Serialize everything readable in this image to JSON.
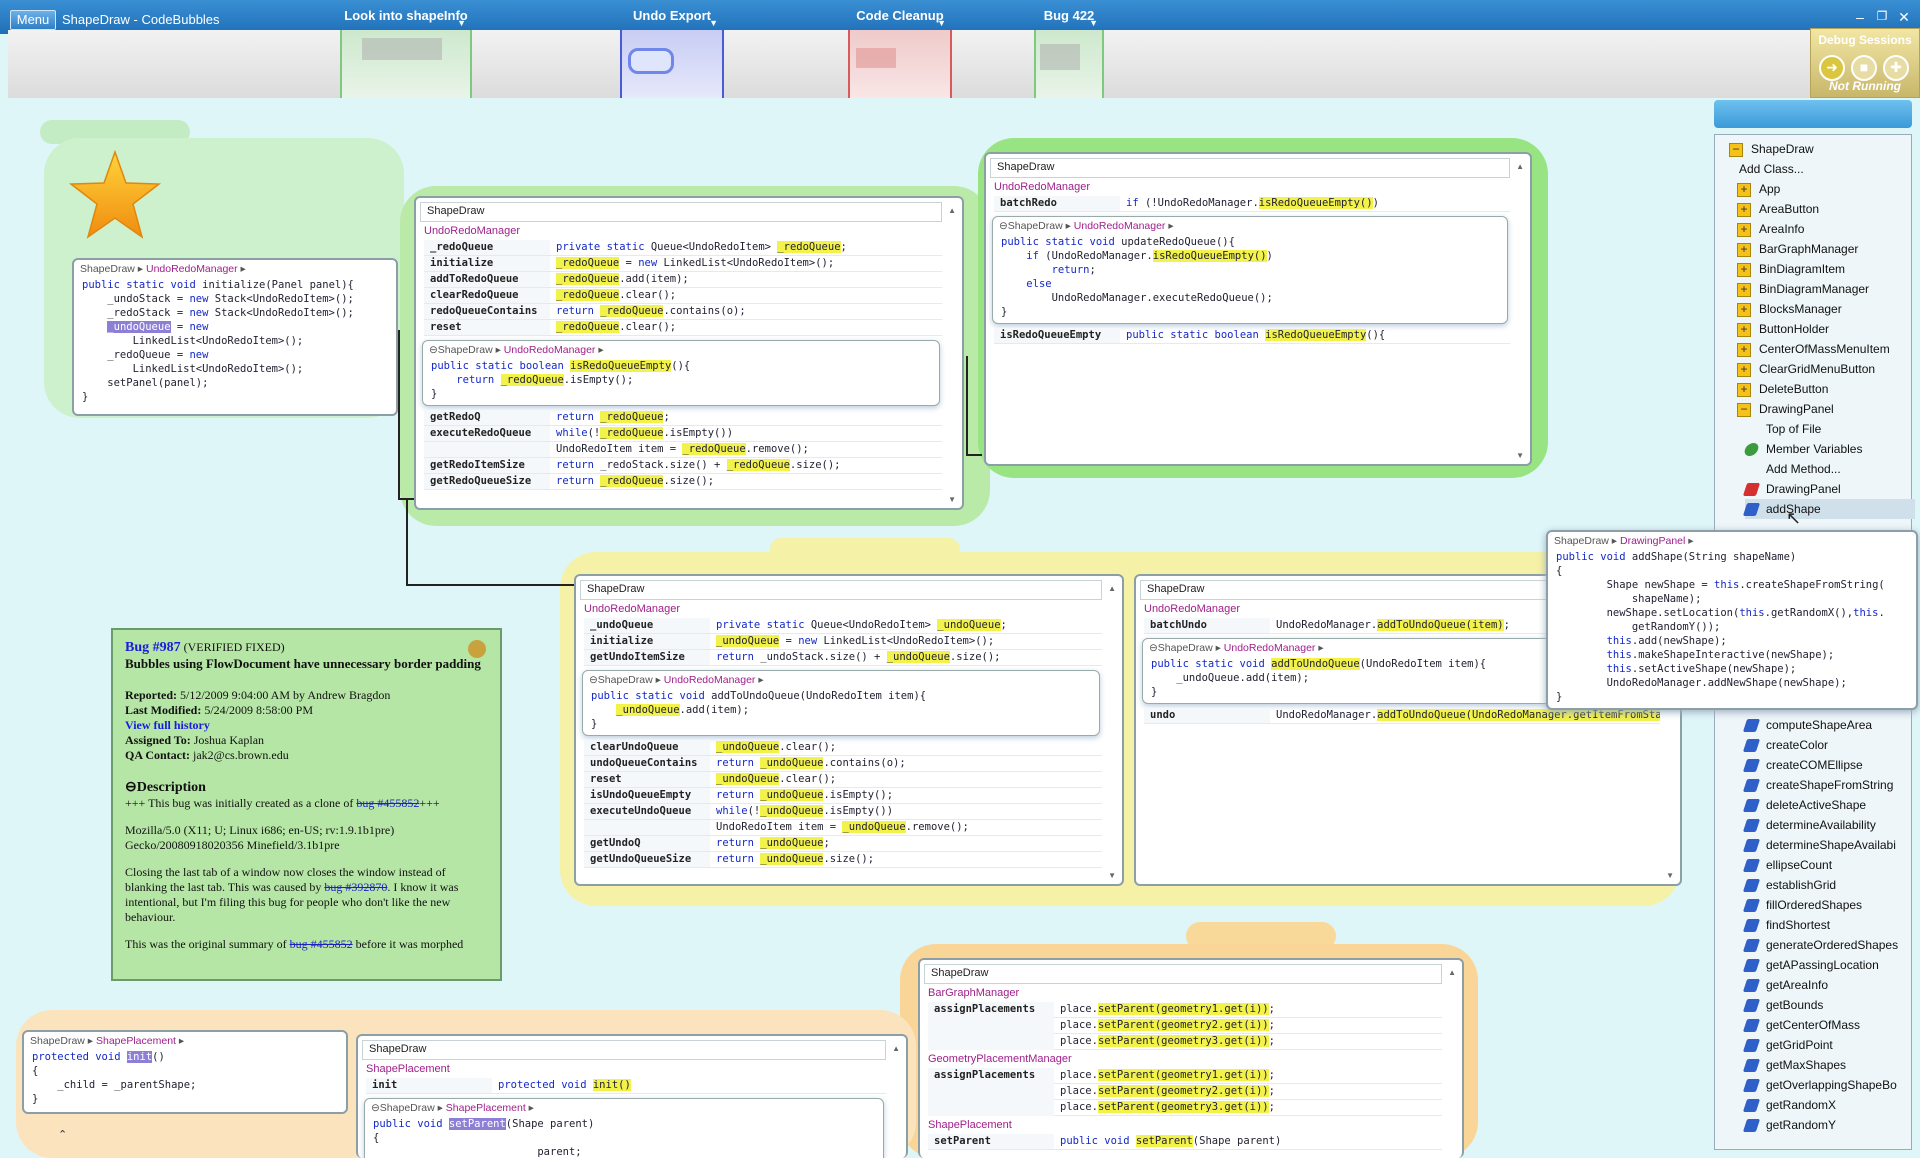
{
  "window": {
    "menu_label": "Menu",
    "title": "ShapeDraw - CodeBubbles"
  },
  "tasks": [
    {
      "label": "Look into shapeInfo",
      "color": "#7fc87f"
    },
    {
      "label": "Undo Export",
      "color": "#4a5ad8"
    },
    {
      "label": "Code Cleanup",
      "color": "#d85a5a"
    },
    {
      "label": "Bug 422",
      "color": "#7fc87f"
    }
  ],
  "debug": {
    "title": "Debug Sessions",
    "status": "Not Running"
  },
  "init_bubble": {
    "project": "ShapeDraw",
    "cls": "UndoRedoManager",
    "lines": [
      "public static void initialize(Panel panel){",
      "    _undoStack = new Stack<UndoRedoItem>();",
      "    _redoStack = new Stack<UndoRedoItem>();",
      "    _undoQueue = new",
      "        LinkedList<UndoRedoItem>();",
      "    _redoQueue = new",
      "        LinkedList<UndoRedoItem>();",
      "    setPanel(panel);",
      "}"
    ]
  },
  "redo_bubble": {
    "project": "ShapeDraw",
    "cls": "UndoRedoManager",
    "rows": [
      {
        "m": "_redoQueue",
        "c": "private static Queue<UndoRedoItem> _redoQueue;"
      },
      {
        "m": "initialize",
        "c": "_redoQueue = new LinkedList<UndoRedoItem>();"
      },
      {
        "m": "addToRedoQueue",
        "c": "_redoQueue.add(item);"
      },
      {
        "m": "clearRedoQueue",
        "c": "_redoQueue.clear();"
      },
      {
        "m": "redoQueueContains",
        "c": "return _redoQueue.contains(o);"
      },
      {
        "m": "reset",
        "c": "_redoQueue.clear();"
      }
    ],
    "inner_crumb": "UndoRedoManager",
    "inner_lines": [
      "public static boolean isRedoQueueEmpty(){",
      "    return _redoQueue.isEmpty();",
      "}"
    ],
    "rows2": [
      {
        "m": "getRedoQ",
        "c": "return _redoQueue;"
      },
      {
        "m": "executeRedoQueue",
        "c": "while(!_redoQueue.isEmpty())"
      },
      {
        "m": "",
        "c": "UndoRedoItem item = _redoQueue.remove();"
      },
      {
        "m": "getRedoItemSize",
        "c": "return _redoStack.size() + _redoQueue.size();"
      },
      {
        "m": "getRedoQueueSize",
        "c": "return _redoQueue.size();"
      }
    ]
  },
  "batch_bubble": {
    "project": "ShapeDraw",
    "cls": "UndoRedoManager",
    "rows": [
      {
        "m": "batchRedo",
        "c": "if (!UndoRedoManager.isRedoQueueEmpty())"
      }
    ],
    "inner_crumb": "UndoRedoManager",
    "inner_lines": [
      "public static void updateRedoQueue(){",
      "    if (UndoRedoManager.isRedoQueueEmpty())",
      "        return;",
      "    else",
      "        UndoRedoManager.executeRedoQueue();",
      "}"
    ],
    "rows2": [
      {
        "m": "isRedoQueueEmpty",
        "c": "public static boolean isRedoQueueEmpty(){"
      }
    ]
  },
  "undo_bubble": {
    "project": "ShapeDraw",
    "cls": "UndoRedoManager",
    "rows": [
      {
        "m": "_undoQueue",
        "c": "private static Queue<UndoRedoItem> _undoQueue;"
      },
      {
        "m": "initialize",
        "c": "_undoQueue = new LinkedList<UndoRedoItem>();"
      },
      {
        "m": "getUndoItemSize",
        "c": "return _undoStack.size() + _undoQueue.size();"
      }
    ],
    "inner_crumb": "UndoRedoManager",
    "inner_lines": [
      "public static void addToUndoQueue(UndoRedoItem item){",
      "    _undoQueue.add(item);",
      "}"
    ],
    "rows2": [
      {
        "m": "clearUndoQueue",
        "c": "_undoQueue.clear();"
      },
      {
        "m": "undoQueueContains",
        "c": "return _undoQueue.contains(o);"
      },
      {
        "m": "reset",
        "c": "_undoQueue.clear();"
      },
      {
        "m": "isUndoQueueEmpty",
        "c": "return _undoQueue.isEmpty();"
      },
      {
        "m": "executeUndoQueue",
        "c": "while(!_undoQueue.isEmpty())"
      },
      {
        "m": "",
        "c": "UndoRedoItem item = _undoQueue.remove();"
      },
      {
        "m": "getUndoQ",
        "c": "return _undoQueue;"
      },
      {
        "m": "getUndoQueueSize",
        "c": "return _undoQueue.size();"
      }
    ]
  },
  "batchundo_bubble": {
    "project": "ShapeDraw",
    "cls": "UndoRedoManager",
    "rows": [
      {
        "m": "batchUndo",
        "c": "UndoRedoManager.addToUndoQueue(item);"
      }
    ],
    "inner_crumb": "UndoRedoManager",
    "inner_lines": [
      "public static void addToUndoQueue(UndoRedoItem item){",
      "    _undoQueue.add(item);",
      "}"
    ],
    "rows2": [
      {
        "m": "undo",
        "c": "UndoRedoManager.addToUndoQueue(UndoRedoManager.getItemFromStack"
      }
    ]
  },
  "addshape_bubble": {
    "project": "ShapeDraw",
    "cls": "DrawingPanel",
    "lines": [
      "public void addShape(String shapeName)",
      "{",
      "        Shape newShape = this.createShapeFromString(",
      "            shapeName);",
      "        newShape.setLocation(this.getRandomX(),this.",
      "            getRandomY());",
      "        this.add(newShape);",
      "        this.makeShapeInteractive(newShape);",
      "        this.setActiveShape(newShape);",
      "        UndoRedoManager.addNewShape(newShape);",
      "}"
    ]
  },
  "bug": {
    "id": "Bug #987",
    "status": "(VERIFIED FIXED)",
    "summary": "Bubbles using FlowDocument have unnecessary border padding",
    "reported_label": "Reported:",
    "reported": "5/12/2009 9:04:00 AM by Andrew Bragdon",
    "modified_label": "Last Modified:",
    "modified": "5/24/2009 8:58:00 PM",
    "history_link": "View full history",
    "assigned_label": "Assigned To:",
    "assigned": "Joshua Kaplan",
    "qa_label": "QA Contact:",
    "qa": "jak2@cs.brown.edu",
    "desc_heading": "Description",
    "p1a": "+++ This bug was initially created as a clone of ",
    "p1link": "bug #455852",
    "p1b": "+++",
    "p2": "Mozilla/5.0 (X11; U; Linux i686; en-US; rv:1.9.1b1pre) Gecko/20080918020356 Minefield/3.1b1pre",
    "p3a": "Closing the last tab of a window now closes the window instead of blanking the last tab. This was caused by ",
    "p3link": "bug #392870",
    "p3b": ". I know it was intentional, but I'm filing this bug for people who don't like the new behaviour.",
    "p4a": "This was the original summary of ",
    "p4link": "bug #455852",
    "p4b": " before it was morphed"
  },
  "init_small": {
    "project": "ShapeDraw",
    "cls": "ShapePlacement",
    "lines": [
      "protected void init()",
      "{",
      "    _child = _parentShape;",
      "}"
    ]
  },
  "placement_bubble": {
    "project": "ShapeDraw",
    "cls": "ShapePlacement",
    "rows": [
      {
        "m": "init",
        "c": "protected void init()"
      }
    ],
    "inner_crumb": "ShapePlacement",
    "inner_lines": [
      "public void setParent(Shape parent)",
      "{",
      "                          parent;"
    ]
  },
  "bargraph_bubble": {
    "project": "ShapeDraw",
    "cls1": "BarGraphManager",
    "m1": "assignPlacements",
    "c1": [
      "place.setParent(geometry1.get(i));",
      "place.setParent(geometry2.get(i));",
      "place.setParent(geometry3.get(i));"
    ],
    "cls2": "GeometryPlacementManager",
    "m2": "assignPlacements",
    "c2": [
      "place.setParent(geometry1.get(i));",
      "place.setParent(geometry2.get(i));",
      "place.setParent(geometry3.get(i));"
    ],
    "cls3": "ShapePlacement",
    "m3": "setParent",
    "c3": "public void setParent(Shape parent)"
  },
  "package_explorer": {
    "root": "ShapeDraw",
    "add_class": "Add Class...",
    "classes": [
      "App",
      "AreaButton",
      "AreaInfo",
      "BarGraphManager",
      "BinDiagramItem",
      "BinDiagramManager",
      "BlocksManager",
      "ButtonHolder",
      "CenterOfMassMenuItem",
      "ClearGridMenuButton",
      "DeleteButton"
    ],
    "expanded": "DrawingPanel",
    "sub_items": [
      {
        "label": "Top of File",
        "icon": "none"
      },
      {
        "label": "Member Variables",
        "icon": "leaf"
      },
      {
        "label": "Add Method...",
        "icon": "none"
      },
      {
        "label": "DrawingPanel",
        "icon": "red"
      },
      {
        "label": "addShape",
        "icon": "blue"
      }
    ],
    "methods": [
      "computeShapeArea",
      "createColor",
      "createCOMEllipse",
      "createShapeFromString",
      "deleteActiveShape",
      "determineAvailability",
      "determineShapeAvailabi",
      "ellipseCount",
      "establishGrid",
      "fillOrderedShapes",
      "findShortest",
      "generateOrderedShapes",
      "getAPassingLocation",
      "getAreaInfo",
      "getBounds",
      "getCenterOfMass",
      "getGridPoint",
      "getMaxShapes",
      "getOverlappingShapeBo",
      "getRandomX",
      "getRandomY"
    ]
  }
}
